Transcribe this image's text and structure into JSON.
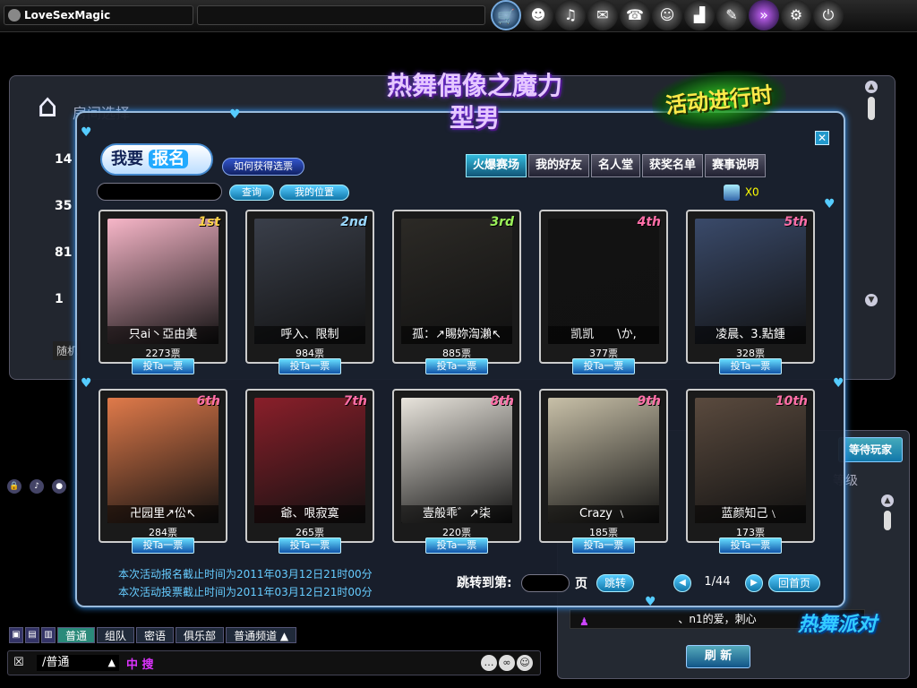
{
  "topbar": {
    "username": "LoveSexMagic",
    "icons": [
      "cart-icon",
      "friend-icon",
      "gift-icon",
      "ticket-icon",
      "chat-icon",
      "group-icon",
      "rank-icon",
      "note-icon",
      "activity-icon",
      "gear-icon",
      "power-icon"
    ],
    "glyphs": [
      "🛒",
      "☻",
      "♫",
      "✉",
      "☎",
      "☺",
      "▟",
      "✎",
      "»",
      "⚙",
      "⏻"
    ]
  },
  "room": {
    "title": "房间选择",
    "numbers": [
      "14",
      "35",
      "81",
      "1"
    ],
    "random": "随机"
  },
  "right_panel": {
    "waiting_label": "等待玩家",
    "level_label": "等级",
    "player_name": "、n1的爱，刺心",
    "refresh_label": "刷 新"
  },
  "chat": {
    "tabs": [
      "普通",
      "组队",
      "密语",
      "俱乐部",
      "普通频道 ▲"
    ],
    "channel": "/普通",
    "input_text": "中 搜",
    "channel_arrow": "▲"
  },
  "game_logo": "热舞派对",
  "popup": {
    "title_logo": "热舞偶像之魔力型男",
    "activity_logo": "活动进行时",
    "close": "✕",
    "signup_prefix": "我要",
    "signup_highlight": "报名",
    "how_vote": "如何获得选票",
    "tabs": [
      {
        "label": "火爆赛场",
        "active": true
      },
      {
        "label": "我的好友",
        "active": false
      },
      {
        "label": "名人堂",
        "active": false
      },
      {
        "label": "获奖名单",
        "active": false
      },
      {
        "label": "赛事说明",
        "active": false
      }
    ],
    "search_btn": "查询",
    "my_rank_btn": "我的位置",
    "ticket_count": "X0",
    "vote_label": "投Ta一票",
    "contestants": [
      {
        "rank": "1st",
        "name": "只ai丶亞由美",
        "votes": "2273票",
        "rank_color": "#ffd24a",
        "bg": "#f7b6c8"
      },
      {
        "rank": "2nd",
        "name": "呼入、限制",
        "votes": "984票",
        "rank_color": "#9ad8ff",
        "bg": "#3a3f4a"
      },
      {
        "rank": "3rd",
        "name": "孤：↗賜妳渹瀨↖",
        "votes": "885票",
        "rank_color": "#9cf25a",
        "bg": "#2c2a26"
      },
      {
        "rank": "4th",
        "name": "凯凯　　\\か,",
        "votes": "377票",
        "rank_color": "#ff6fa8",
        "bg": "#121212"
      },
      {
        "rank": "5th",
        "name": "凌晨、3.點鍾",
        "votes": "328票",
        "rank_color": "#ff6fa8",
        "bg": "#3a4a6a"
      },
      {
        "rank": "6th",
        "name": "卍园里↗伀↖",
        "votes": "284票",
        "rank_color": "#ff6fa8",
        "bg": "#e07a4a"
      },
      {
        "rank": "7th",
        "name": "爺、哏寂寞",
        "votes": "265票",
        "rank_color": "#ff6fa8",
        "bg": "#8a1f2a"
      },
      {
        "rank": "8th",
        "name": "壹般乖゛↗柒",
        "votes": "220票",
        "rank_color": "#ff6fa8",
        "bg": "#e8e4dc"
      },
      {
        "rank": "9th",
        "name": "Crazy ﹨",
        "votes": "185票",
        "rank_color": "#ff6fa8",
        "bg": "#c8c0a8"
      },
      {
        "rank": "10th",
        "name": "蓝颜知己﹨",
        "votes": "173票",
        "rank_color": "#ff6fa8",
        "bg": "#5a4a3e"
      }
    ],
    "notice_signup": "本次活动报名截止时间为2011年03月12日21时00分",
    "notice_vote": "本次活动投票截止时间为2011年03月12日21时00分",
    "jump_label": "跳转到第:",
    "page_label": "页",
    "jump_btn": "跳转",
    "page_indicator": "1/44",
    "prev": "◀",
    "next": "▶",
    "home_btn": "回首页"
  },
  "colors": {
    "accent": "#33aadd",
    "panel_border": "#99bbdd",
    "rank_pink": "#ff6fa8",
    "notice": "#66ccff"
  }
}
